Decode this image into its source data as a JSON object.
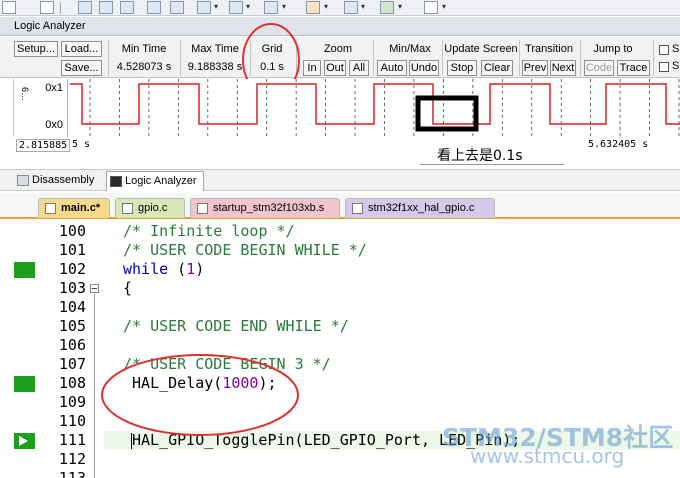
{
  "panel_title": "Logic Analyzer",
  "controls": {
    "setup": "Setup...",
    "load": "Load...",
    "save": "Save...",
    "min_time": {
      "label": "Min Time",
      "value": "4.528073 s"
    },
    "max_time": {
      "label": "Max Time",
      "value": "9.188338 s"
    },
    "grid": {
      "label": "Grid",
      "value": "0.1 s"
    },
    "zoom": {
      "label": "Zoom",
      "in": "In",
      "out": "Out",
      "all": "All"
    },
    "minmax": {
      "label": "Min/Max",
      "auto": "Auto",
      "undo": "Undo"
    },
    "update_screen": {
      "label": "Update Screen",
      "stop": "Stop",
      "clear": "Clear"
    },
    "transition": {
      "label": "Transition",
      "prev": "Prev",
      "next": "Next"
    },
    "jump_to": {
      "label": "Jump to",
      "code": "Code",
      "trace": "Trace"
    },
    "checkbox_1": "S",
    "checkbox_2": "S"
  },
  "waveform": {
    "high_label": "0x1",
    "low_label": "0x0",
    "signal_glyph": "6\u0001…",
    "signal_period_s": 0.2,
    "signal_color": "#e02020"
  },
  "timebar": {
    "left_time": "2.815885",
    "left_suffix": "5 s",
    "right_time": "5.632405 s",
    "annotation": "看上去是0.1s"
  },
  "view_tabs": [
    {
      "label": "Disassembly",
      "active": false
    },
    {
      "label": "Logic Analyzer",
      "active": true
    }
  ],
  "file_tabs": [
    {
      "label": "main.c*",
      "color": "#f6d98a"
    },
    {
      "label": "gpio.c",
      "color": "#d9e6b8"
    },
    {
      "label": "startup_stm32f103xb.s",
      "color": "#f2c4cc"
    },
    {
      "label": "stm32f1xx_hal_gpio.c",
      "color": "#d6c8ea"
    }
  ],
  "code_lines": [
    {
      "num": "100",
      "text": "/* Infinite loop */",
      "kind": "cmt"
    },
    {
      "num": "101",
      "text": "/* USER CODE BEGIN WHILE */",
      "kind": "cmt"
    },
    {
      "num": "102",
      "text": "while (1)",
      "kind": "kw"
    },
    {
      "num": "103",
      "text": "{",
      "kind": "plain"
    },
    {
      "num": "104",
      "text": "",
      "kind": "plain"
    },
    {
      "num": "105",
      "text": "/* USER CODE END WHILE */",
      "kind": "cmt"
    },
    {
      "num": "106",
      "text": "",
      "kind": "plain"
    },
    {
      "num": "107",
      "text": "/* USER CODE BEGIN 3 */",
      "kind": "cmt"
    },
    {
      "num": "108",
      "text": " HAL_Delay(1000);",
      "kind": "call"
    },
    {
      "num": "109",
      "text": "",
      "kind": "plain"
    },
    {
      "num": "110",
      "text": "",
      "kind": "plain"
    },
    {
      "num": "111",
      "text": "HAL_GPIO_TogglePin(LED_GPIO_Port, LED_Pin);",
      "kind": "plain"
    },
    {
      "num": "112",
      "text": "",
      "kind": "plain"
    },
    {
      "num": "113",
      "text": "",
      "kind": "plain"
    }
  ],
  "code_parts": {
    "while_kw": "while",
    "while_rest_open": " (",
    "while_num": "1",
    "while_close": ")",
    "delay_fn": " HAL_Delay(",
    "delay_num": "1000",
    "delay_end": ");"
  },
  "watermark": {
    "line1": "STM32/STM8社区",
    "line2": "www.stmcu.org"
  },
  "colors": {
    "annotation_ellipse": "#e03030",
    "breakpoint_marker": "#1e9e1e",
    "tab_underline": "#e6a233"
  }
}
